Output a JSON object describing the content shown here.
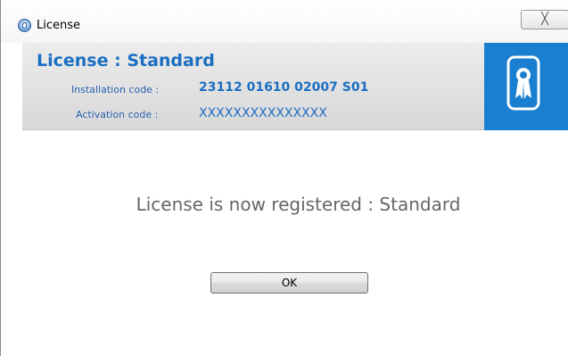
{
  "window": {
    "title": "License",
    "close_glyph": "╳"
  },
  "header": {
    "title": "License : Standard",
    "installation_label": "Installation code :",
    "installation_value": "23112 01610 02007 S01",
    "activation_label": "Activation code :",
    "activation_value": "XXXXXXXXXXXXXXX",
    "badge_icon": "certificate-ribbon-icon"
  },
  "main": {
    "status": "License is now registered : Standard",
    "ok_label": "OK"
  },
  "colors": {
    "accent": "#1b6fc2",
    "badge_bg": "#1a7fd0",
    "status_text": "#666666"
  }
}
